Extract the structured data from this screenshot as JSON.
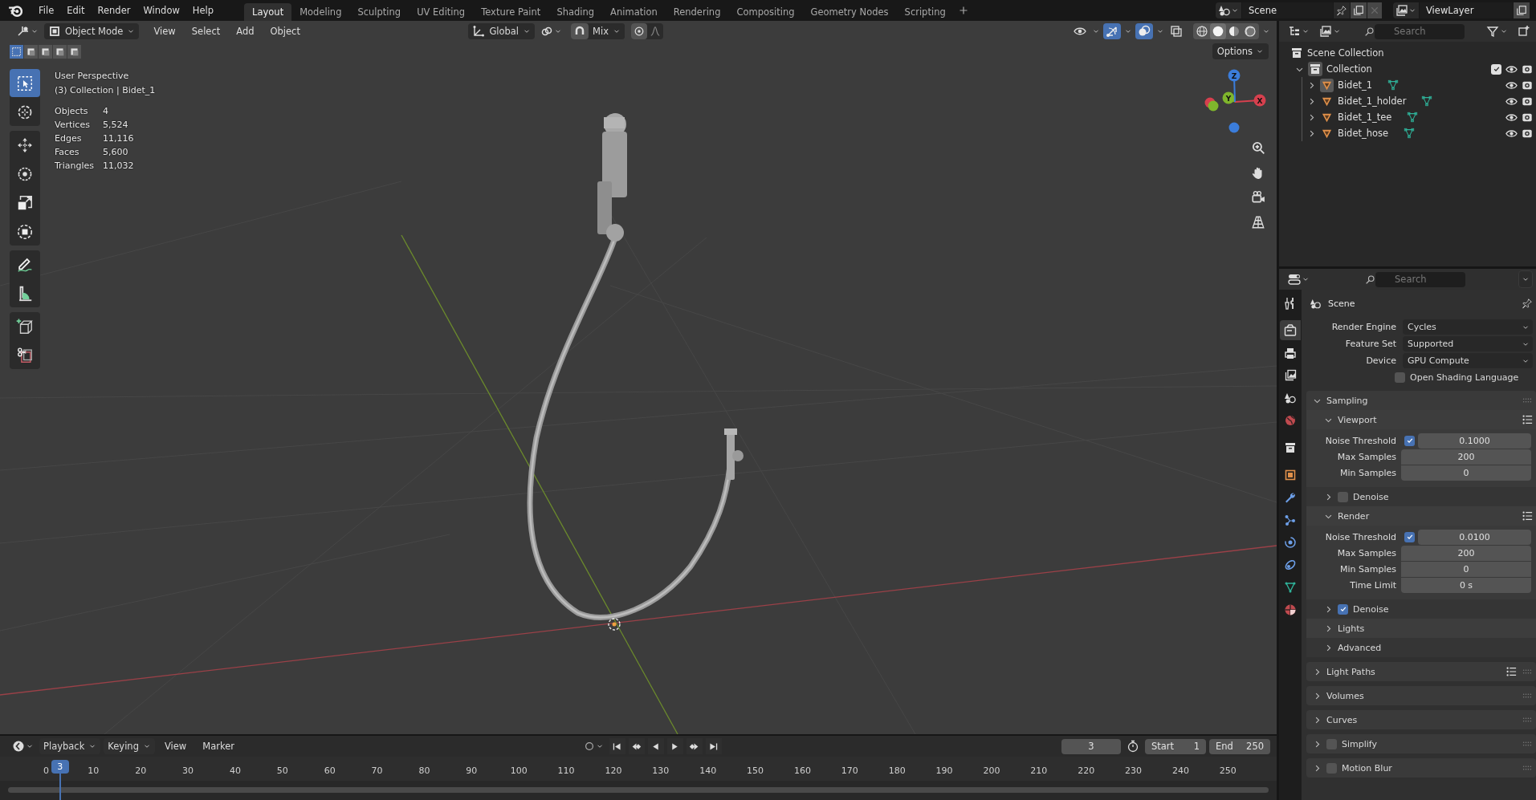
{
  "topbar": {
    "menus": [
      "File",
      "Edit",
      "Render",
      "Window",
      "Help"
    ],
    "workspaces": [
      {
        "label": "Layout",
        "selected": true
      },
      {
        "label": "Modeling",
        "selected": false
      },
      {
        "label": "Sculpting",
        "selected": false
      },
      {
        "label": "UV Editing",
        "selected": false
      },
      {
        "label": "Texture Paint",
        "selected": false
      },
      {
        "label": "Shading",
        "selected": false
      },
      {
        "label": "Animation",
        "selected": false
      },
      {
        "label": "Rendering",
        "selected": false
      },
      {
        "label": "Compositing",
        "selected": false
      },
      {
        "label": "Geometry Nodes",
        "selected": false
      },
      {
        "label": "Scripting",
        "selected": false
      }
    ],
    "scene": "Scene",
    "view_layer": "ViewLayer"
  },
  "viewport": {
    "header": {
      "mode": "Object Mode",
      "menus": [
        "View",
        "Select",
        "Add",
        "Object"
      ],
      "orientation": "Global",
      "snap_target": "Mix"
    },
    "toggles": [
      {
        "kind": "visibility",
        "selected": false
      },
      {
        "kind": "gizmo",
        "selected": true
      },
      {
        "kind": "overlay",
        "selected": true
      },
      {
        "kind": "xray",
        "selected": false
      }
    ],
    "shading": [
      {
        "kind": "wireframe",
        "selected": false
      },
      {
        "kind": "solid",
        "selected": true
      },
      {
        "kind": "material",
        "selected": false
      },
      {
        "kind": "rendered",
        "selected": false
      }
    ],
    "select_modes": [
      {
        "kind": "set",
        "selected": true
      },
      {
        "kind": "extend",
        "selected": false
      },
      {
        "kind": "subtract",
        "selected": false
      },
      {
        "kind": "difference",
        "selected": false
      },
      {
        "kind": "intersect",
        "selected": false
      }
    ],
    "options_label": "Options",
    "tool_groups": [
      {
        "tools": [
          {
            "kind": "select",
            "selected": true
          },
          {
            "kind": "cursor",
            "selected": false
          }
        ]
      },
      {
        "tools": [
          {
            "kind": "move",
            "selected": false
          },
          {
            "kind": "rotate",
            "selected": false
          },
          {
            "kind": "scale",
            "selected": false
          },
          {
            "kind": "transform",
            "selected": false
          }
        ]
      },
      {
        "tools": [
          {
            "kind": "annotate",
            "selected": false
          },
          {
            "kind": "measure",
            "selected": false
          }
        ]
      },
      {
        "tools": [
          {
            "kind": "add_cube",
            "selected": false
          },
          {
            "kind": "cage",
            "selected": false
          }
        ]
      }
    ],
    "view_name": "User Perspective",
    "context": "(3) Collection | Bidet_1",
    "stats": [
      {
        "label": "Objects",
        "value": "4"
      },
      {
        "label": "Vertices",
        "value": "5,524"
      },
      {
        "label": "Edges",
        "value": "11,116"
      },
      {
        "label": "Faces",
        "value": "5,600"
      },
      {
        "label": "Triangles",
        "value": "11,032"
      }
    ],
    "nav_gizmo": {
      "axes": [
        {
          "label": "X",
          "color": "#d6404e"
        },
        {
          "label": "Y",
          "color": "#7fb52c"
        },
        {
          "label": "Z",
          "color": "#3b7ddb"
        }
      ]
    },
    "nav_buttons": [
      {
        "kind": "zoom"
      },
      {
        "kind": "pan"
      },
      {
        "kind": "camera"
      },
      {
        "kind": "ortho"
      }
    ]
  },
  "timeline": {
    "menus": [
      "Playback",
      "Keying",
      "View",
      "Marker"
    ],
    "current_frame": "3",
    "start": {
      "label": "Start",
      "value": "1"
    },
    "end": {
      "label": "End",
      "value": "250"
    },
    "ruler": [
      "0",
      "10",
      "20",
      "30",
      "40",
      "50",
      "60",
      "70",
      "80",
      "90",
      "100",
      "110",
      "120",
      "130",
      "140",
      "150",
      "160",
      "170",
      "180",
      "190",
      "200",
      "210",
      "220",
      "230",
      "240",
      "250"
    ],
    "playhead": "3"
  },
  "outliner": {
    "search": {
      "placeholder": "Search"
    },
    "root": "Scene Collection",
    "collections": [
      {
        "label": "Collection",
        "expanded": true,
        "checked": true,
        "children": [
          {
            "label": "Bidet_1",
            "active": true,
            "expanded": false
          },
          {
            "label": "Bidet_1_holder",
            "active": false,
            "expanded": false
          },
          {
            "label": "Bidet_1_tee",
            "active": false,
            "expanded": false
          },
          {
            "label": "Bidet_hose",
            "active": false,
            "expanded": false
          }
        ]
      }
    ]
  },
  "properties": {
    "search": {
      "placeholder": "Search"
    },
    "tabs": [
      {
        "kind": "tool",
        "selected": false
      },
      {
        "kind": "render",
        "selected": true
      },
      {
        "kind": "output",
        "selected": false
      },
      {
        "kind": "view_layer",
        "selected": false
      },
      {
        "kind": "scene",
        "selected": false
      },
      {
        "kind": "world",
        "selected": false
      },
      {
        "kind": "collection",
        "selected": false
      },
      {
        "kind": "object",
        "selected": false
      },
      {
        "kind": "modifiers",
        "selected": false
      },
      {
        "kind": "particles",
        "selected": false
      },
      {
        "kind": "physics",
        "selected": false
      },
      {
        "kind": "constraints",
        "selected": false
      },
      {
        "kind": "data",
        "selected": false
      },
      {
        "kind": "material",
        "selected": false
      }
    ],
    "context": "Scene",
    "fields": [
      {
        "label": "Render Engine",
        "value": "Cycles"
      },
      {
        "label": "Feature Set",
        "value": "Supported"
      },
      {
        "label": "Device",
        "value": "GPU Compute"
      }
    ],
    "options": [
      {
        "label": "Open Shading Language",
        "checked": false
      }
    ],
    "panels": [
      {
        "title": "Sampling",
        "expanded": true,
        "subpanels": [
          {
            "title": "Viewport",
            "expanded": true,
            "presets": true,
            "rows": [
              {
                "kind": "toggle_number",
                "label": "Noise Threshold",
                "checked": true,
                "value": "0.1000"
              },
              {
                "kind": "number",
                "label": "Max Samples",
                "value": "200"
              },
              {
                "kind": "number",
                "label": "Min Samples",
                "value": "0"
              }
            ]
          },
          {
            "title": "Denoise",
            "expanded": false,
            "checked": false
          },
          {
            "title": "Render",
            "expanded": true,
            "presets": true,
            "rows": [
              {
                "kind": "toggle_number",
                "label": "Noise Threshold",
                "checked": true,
                "value": "0.0100"
              },
              {
                "kind": "number",
                "label": "Max Samples",
                "value": "200"
              },
              {
                "kind": "number",
                "label": "Min Samples",
                "value": "0"
              },
              {
                "kind": "number",
                "label": "Time Limit",
                "value": "0 s"
              }
            ]
          },
          {
            "title": "Denoise",
            "expanded": false,
            "checked": true
          },
          {
            "title": "Lights",
            "expanded": false
          },
          {
            "title": "Advanced",
            "expanded": false
          }
        ]
      },
      {
        "title": "Light Paths",
        "expanded": false,
        "presets": true
      },
      {
        "title": "Volumes",
        "expanded": false
      },
      {
        "title": "Curves",
        "expanded": false
      },
      {
        "title": "Simplify",
        "expanded": false,
        "checked": false
      },
      {
        "title": "Motion Blur",
        "expanded": false,
        "checked": false
      }
    ]
  }
}
